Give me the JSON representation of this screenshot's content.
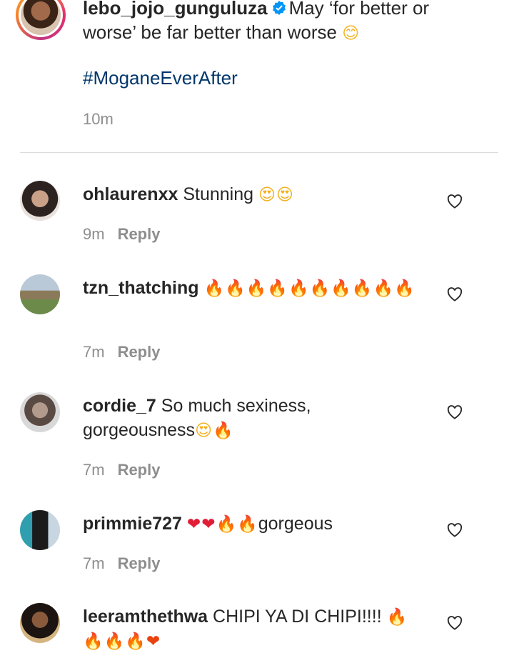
{
  "caption": {
    "username": "lebo_jojo_gunguluza",
    "text": "May ‘for better or worse’ be far better than worse",
    "emoji": "😊",
    "hashtag": "#MoganeEverAfter",
    "time": "10m"
  },
  "comments": [
    {
      "username": "ohlaurenxx",
      "text": "Stunning",
      "emoji": "😍😍",
      "time": "9m",
      "reply_label": "Reply"
    },
    {
      "username": "tzn_thatching",
      "text": "",
      "emoji": "🔥🔥🔥🔥🔥🔥🔥🔥🔥🔥",
      "time": "7m",
      "reply_label": "Reply"
    },
    {
      "username": "cordie_7",
      "text": "So much sexiness, gorgeousness",
      "emoji": "😍🔥",
      "time": "7m",
      "reply_label": "Reply"
    },
    {
      "username": "primmie727",
      "text_prefix": "❤❤🔥🔥",
      "text": "gorgeous",
      "time": "7m",
      "reply_label": "Reply"
    },
    {
      "username": "leeramthethwa",
      "text": "CHIPI YA DI CHIPI!!!!",
      "emoji": "🔥🔥🔥🔥❤",
      "time": "",
      "reply_label": ""
    }
  ],
  "icons": {
    "verified": "verified-badge-icon",
    "like": "heart-outline-icon"
  },
  "colors": {
    "hashtag": "#00376b",
    "muted": "#8e8e8e",
    "verified": "#0095f6"
  }
}
